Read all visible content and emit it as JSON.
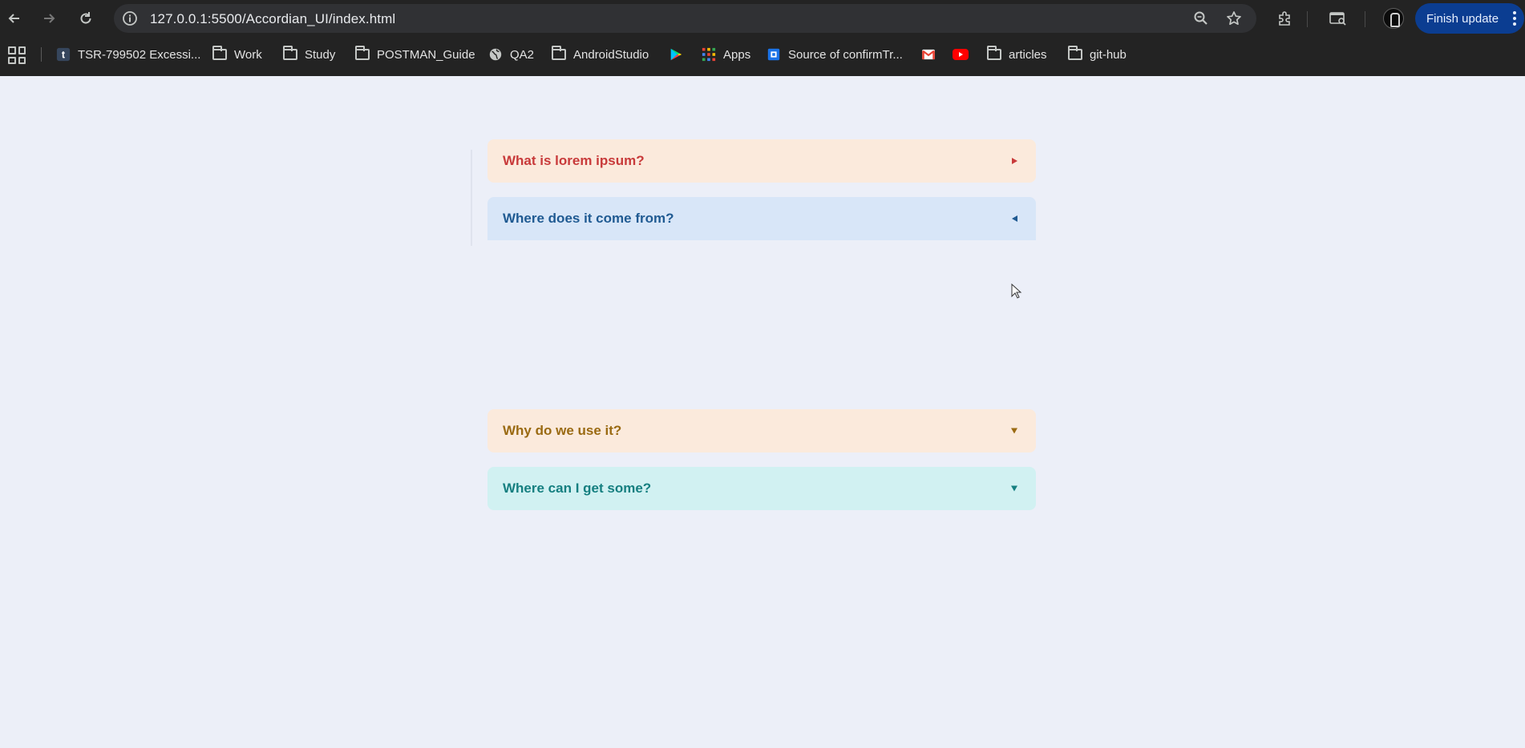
{
  "browser": {
    "url": "127.0.0.1:5500/Accordian_UI/index.html",
    "finish_update_label": "Finish update",
    "icons": [
      "back-icon",
      "forward-icon",
      "reload-icon",
      "site-info-icon",
      "zoom-icon",
      "star-icon",
      "extensions-icon",
      "tab-search-icon",
      "profile-icon",
      "menu-icon"
    ]
  },
  "bookmarks": [
    {
      "label": "TSR-799502 Excessi...",
      "icon": "tumblr-icon"
    },
    {
      "label": "Work",
      "icon": "folder-icon"
    },
    {
      "label": "Study",
      "icon": "folder-icon"
    },
    {
      "label": "POSTMAN_Guide",
      "icon": "folder-icon"
    },
    {
      "label": "QA2",
      "icon": "globe-icon"
    },
    {
      "label": "AndroidStudio",
      "icon": "folder-icon"
    },
    {
      "label": "",
      "icon": "play-store-icon"
    },
    {
      "label": "Apps",
      "icon": "apps-icon"
    },
    {
      "label": "Source of confirmTr...",
      "icon": "bookmark-site-icon"
    },
    {
      "label": "",
      "icon": "gmail-icon"
    },
    {
      "label": "",
      "icon": "youtube-icon"
    },
    {
      "label": "articles",
      "icon": "folder-icon"
    },
    {
      "label": "git-hub",
      "icon": "folder-icon"
    }
  ],
  "accordion": [
    {
      "title": "What is lorem ipsum?",
      "color": "#c83a3a",
      "bg": "#fbeadc",
      "state": "collapsed",
      "arrow": "right"
    },
    {
      "title": "Where does it come from?",
      "color": "#1f5a92",
      "bg": "#d8e6f8",
      "state": "expanded",
      "arrow": "left"
    },
    {
      "title": "Why do we use it?",
      "color": "#9a6a12",
      "bg": "#fbeadc",
      "state": "collapsed",
      "arrow": "down"
    },
    {
      "title": "Where can I get some?",
      "color": "#157f80",
      "bg": "#d1f1f2",
      "state": "collapsed",
      "arrow": "down"
    }
  ]
}
